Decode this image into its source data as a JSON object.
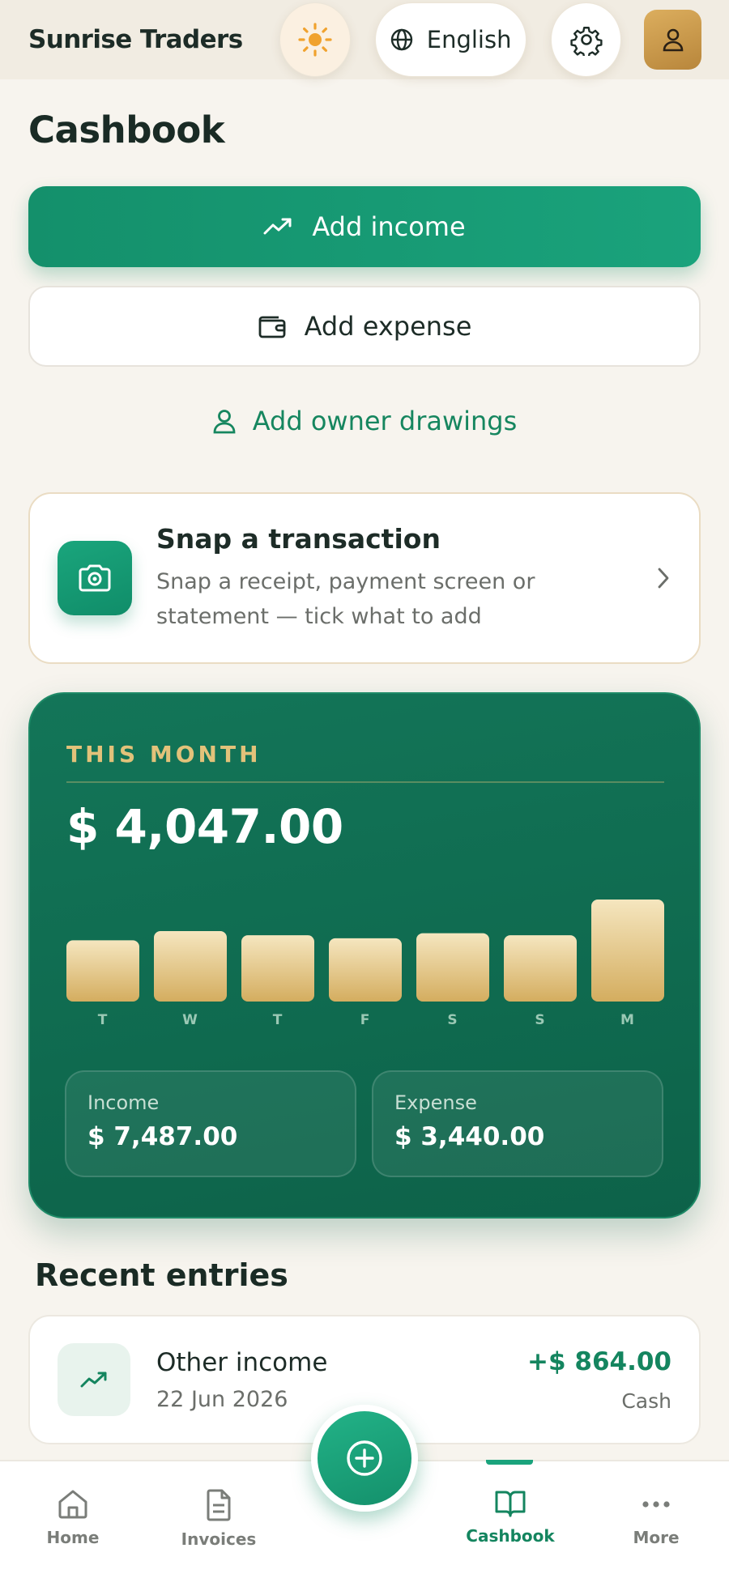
{
  "header": {
    "brand": "Sunrise Traders",
    "language_label": "English",
    "icons": {
      "theme": "sun-icon",
      "language": "globe-icon",
      "settings": "gear-icon",
      "profile": "user-icon"
    }
  },
  "page": {
    "title": "Cashbook"
  },
  "actions": {
    "add_income": "Add income",
    "add_expense": "Add expense",
    "add_drawings": "Add owner drawings"
  },
  "snap": {
    "title": "Snap a transaction",
    "description": "Snap a receipt, payment screen or statement — tick what to add"
  },
  "month": {
    "label": "THIS MONTH",
    "total": "$ 4,047.00",
    "income_label": "Income",
    "income_value": "$ 7,487.00",
    "expense_label": "Expense",
    "expense_value": "$ 3,440.00"
  },
  "chart_data": {
    "type": "bar",
    "categories": [
      "T",
      "W",
      "T",
      "F",
      "S",
      "S",
      "M"
    ],
    "values": [
      0.6,
      0.69,
      0.65,
      0.62,
      0.67,
      0.65,
      1.0
    ],
    "ylim": [
      0,
      1
    ],
    "colors": {
      "bar_top": "#f5e6bf",
      "bar_bottom": "#d4ad5f"
    }
  },
  "recent": {
    "title": "Recent entries",
    "entries": [
      {
        "name": "Other income",
        "date": "22 Jun 2026",
        "amount": "+$ 864.00",
        "method": "Cash"
      }
    ]
  },
  "nav": {
    "items": [
      {
        "label": "Home"
      },
      {
        "label": "Invoices"
      },
      {
        "label": "Cashbook"
      },
      {
        "label": "More"
      }
    ],
    "active": "Cashbook"
  },
  "colors": {
    "primary": "#14906b",
    "accent_gold": "#e2c27a",
    "background": "#f7f4ee"
  }
}
